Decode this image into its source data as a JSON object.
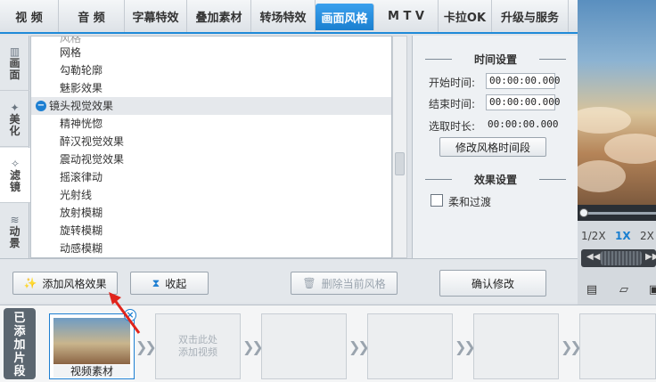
{
  "top_tabs": [
    {
      "label": "视  频",
      "width": 66
    },
    {
      "label": "音  频",
      "width": 74
    },
    {
      "label": "字幕特效",
      "width": 70
    },
    {
      "label": "叠加素材",
      "width": 72
    },
    {
      "label": "转场特效",
      "width": 72
    },
    {
      "label": "画面风格",
      "width": 66,
      "active": true
    },
    {
      "label": "M T V",
      "width": 72
    },
    {
      "label": "卡拉OK",
      "width": 60
    },
    {
      "label": "升级与服务",
      "width": 86
    }
  ],
  "side_tabs": [
    {
      "label": "画面",
      "icon": "▥"
    },
    {
      "label": "美化",
      "icon": "✦"
    },
    {
      "label": "滤镜",
      "icon": "✧",
      "active": true
    },
    {
      "label": "动景",
      "icon": "≋"
    }
  ],
  "tree": {
    "clipped_item": "风格",
    "items": [
      {
        "label": "网格",
        "type": "child"
      },
      {
        "label": "勾勒轮廓",
        "type": "child"
      },
      {
        "label": "魅影效果",
        "type": "child"
      },
      {
        "label": "镜头视觉效果",
        "type": "group"
      },
      {
        "label": "精神恍惚",
        "type": "child"
      },
      {
        "label": "醉汉视觉效果",
        "type": "child"
      },
      {
        "label": "震动视觉效果",
        "type": "child"
      },
      {
        "label": "摇滚律动",
        "type": "child"
      },
      {
        "label": "光射线",
        "type": "child"
      },
      {
        "label": "放射模糊",
        "type": "child"
      },
      {
        "label": "旋转模糊",
        "type": "child"
      },
      {
        "label": "动感模糊",
        "type": "child"
      }
    ]
  },
  "settings": {
    "time_title": "时间设置",
    "start_label": "开始时间:",
    "start_value": "00:00:00.000",
    "end_label": "结束时间:",
    "end_value": "00:00:00.000",
    "duration_label": "选取时长:",
    "duration_value": "00:00:00.000",
    "modify_time_button": "修改风格时间段",
    "effect_title": "效果设置",
    "soft_transition_label": "柔和过渡",
    "soft_transition_checked": false
  },
  "actions": {
    "add_style": "添加风格效果",
    "collapse": "收起",
    "delete_style": "删除当前风格",
    "confirm": "确认修改"
  },
  "preview": {
    "speeds": [
      "1/2X",
      "1X",
      "2X"
    ],
    "active_speed": "1X"
  },
  "clips": {
    "label": "已添加片段",
    "first_clip_caption": "视频素材",
    "empty_hint_line1": "双击此处",
    "empty_hint_line2": "添加视频"
  }
}
